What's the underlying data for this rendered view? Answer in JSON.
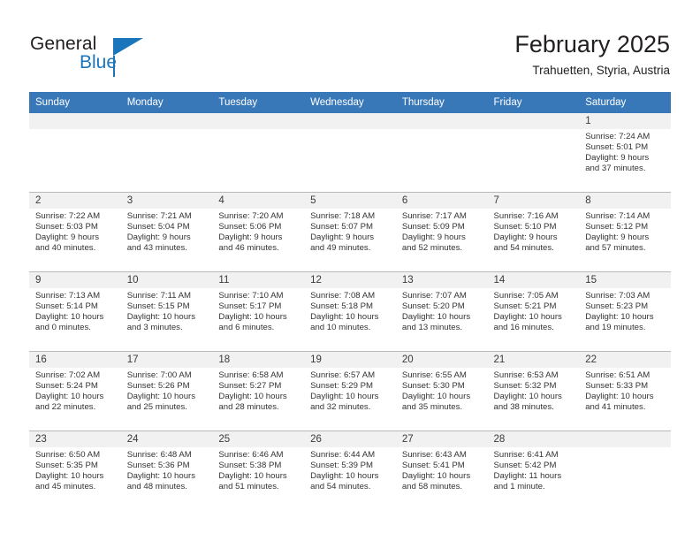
{
  "logo": {
    "word_one": "General",
    "word_two": "Blue",
    "triangle_icon": "triangle-icon",
    "brand_color": "#1b75bb"
  },
  "header": {
    "title": "February 2025",
    "location": "Trahuetten, Styria, Austria",
    "header_bg": "#3878b8"
  },
  "calendar": {
    "weekday_headers": [
      "Sunday",
      "Monday",
      "Tuesday",
      "Wednesday",
      "Thursday",
      "Friday",
      "Saturday"
    ],
    "weeks": [
      [
        {
          "day": "",
          "blank": true
        },
        {
          "day": "",
          "blank": true
        },
        {
          "day": "",
          "blank": true
        },
        {
          "day": "",
          "blank": true
        },
        {
          "day": "",
          "blank": true
        },
        {
          "day": "",
          "blank": true
        },
        {
          "day": "1",
          "sunrise": "Sunrise: 7:24 AM",
          "sunset": "Sunset: 5:01 PM",
          "daylight_1": "Daylight: 9 hours",
          "daylight_2": "and 37 minutes."
        }
      ],
      [
        {
          "day": "2",
          "sunrise": "Sunrise: 7:22 AM",
          "sunset": "Sunset: 5:03 PM",
          "daylight_1": "Daylight: 9 hours",
          "daylight_2": "and 40 minutes."
        },
        {
          "day": "3",
          "sunrise": "Sunrise: 7:21 AM",
          "sunset": "Sunset: 5:04 PM",
          "daylight_1": "Daylight: 9 hours",
          "daylight_2": "and 43 minutes."
        },
        {
          "day": "4",
          "sunrise": "Sunrise: 7:20 AM",
          "sunset": "Sunset: 5:06 PM",
          "daylight_1": "Daylight: 9 hours",
          "daylight_2": "and 46 minutes."
        },
        {
          "day": "5",
          "sunrise": "Sunrise: 7:18 AM",
          "sunset": "Sunset: 5:07 PM",
          "daylight_1": "Daylight: 9 hours",
          "daylight_2": "and 49 minutes."
        },
        {
          "day": "6",
          "sunrise": "Sunrise: 7:17 AM",
          "sunset": "Sunset: 5:09 PM",
          "daylight_1": "Daylight: 9 hours",
          "daylight_2": "and 52 minutes."
        },
        {
          "day": "7",
          "sunrise": "Sunrise: 7:16 AM",
          "sunset": "Sunset: 5:10 PM",
          "daylight_1": "Daylight: 9 hours",
          "daylight_2": "and 54 minutes."
        },
        {
          "day": "8",
          "sunrise": "Sunrise: 7:14 AM",
          "sunset": "Sunset: 5:12 PM",
          "daylight_1": "Daylight: 9 hours",
          "daylight_2": "and 57 minutes."
        }
      ],
      [
        {
          "day": "9",
          "sunrise": "Sunrise: 7:13 AM",
          "sunset": "Sunset: 5:14 PM",
          "daylight_1": "Daylight: 10 hours",
          "daylight_2": "and 0 minutes."
        },
        {
          "day": "10",
          "sunrise": "Sunrise: 7:11 AM",
          "sunset": "Sunset: 5:15 PM",
          "daylight_1": "Daylight: 10 hours",
          "daylight_2": "and 3 minutes."
        },
        {
          "day": "11",
          "sunrise": "Sunrise: 7:10 AM",
          "sunset": "Sunset: 5:17 PM",
          "daylight_1": "Daylight: 10 hours",
          "daylight_2": "and 6 minutes."
        },
        {
          "day": "12",
          "sunrise": "Sunrise: 7:08 AM",
          "sunset": "Sunset: 5:18 PM",
          "daylight_1": "Daylight: 10 hours",
          "daylight_2": "and 10 minutes."
        },
        {
          "day": "13",
          "sunrise": "Sunrise: 7:07 AM",
          "sunset": "Sunset: 5:20 PM",
          "daylight_1": "Daylight: 10 hours",
          "daylight_2": "and 13 minutes."
        },
        {
          "day": "14",
          "sunrise": "Sunrise: 7:05 AM",
          "sunset": "Sunset: 5:21 PM",
          "daylight_1": "Daylight: 10 hours",
          "daylight_2": "and 16 minutes."
        },
        {
          "day": "15",
          "sunrise": "Sunrise: 7:03 AM",
          "sunset": "Sunset: 5:23 PM",
          "daylight_1": "Daylight: 10 hours",
          "daylight_2": "and 19 minutes."
        }
      ],
      [
        {
          "day": "16",
          "sunrise": "Sunrise: 7:02 AM",
          "sunset": "Sunset: 5:24 PM",
          "daylight_1": "Daylight: 10 hours",
          "daylight_2": "and 22 minutes."
        },
        {
          "day": "17",
          "sunrise": "Sunrise: 7:00 AM",
          "sunset": "Sunset: 5:26 PM",
          "daylight_1": "Daylight: 10 hours",
          "daylight_2": "and 25 minutes."
        },
        {
          "day": "18",
          "sunrise": "Sunrise: 6:58 AM",
          "sunset": "Sunset: 5:27 PM",
          "daylight_1": "Daylight: 10 hours",
          "daylight_2": "and 28 minutes."
        },
        {
          "day": "19",
          "sunrise": "Sunrise: 6:57 AM",
          "sunset": "Sunset: 5:29 PM",
          "daylight_1": "Daylight: 10 hours",
          "daylight_2": "and 32 minutes."
        },
        {
          "day": "20",
          "sunrise": "Sunrise: 6:55 AM",
          "sunset": "Sunset: 5:30 PM",
          "daylight_1": "Daylight: 10 hours",
          "daylight_2": "and 35 minutes."
        },
        {
          "day": "21",
          "sunrise": "Sunrise: 6:53 AM",
          "sunset": "Sunset: 5:32 PM",
          "daylight_1": "Daylight: 10 hours",
          "daylight_2": "and 38 minutes."
        },
        {
          "day": "22",
          "sunrise": "Sunrise: 6:51 AM",
          "sunset": "Sunset: 5:33 PM",
          "daylight_1": "Daylight: 10 hours",
          "daylight_2": "and 41 minutes."
        }
      ],
      [
        {
          "day": "23",
          "sunrise": "Sunrise: 6:50 AM",
          "sunset": "Sunset: 5:35 PM",
          "daylight_1": "Daylight: 10 hours",
          "daylight_2": "and 45 minutes."
        },
        {
          "day": "24",
          "sunrise": "Sunrise: 6:48 AM",
          "sunset": "Sunset: 5:36 PM",
          "daylight_1": "Daylight: 10 hours",
          "daylight_2": "and 48 minutes."
        },
        {
          "day": "25",
          "sunrise": "Sunrise: 6:46 AM",
          "sunset": "Sunset: 5:38 PM",
          "daylight_1": "Daylight: 10 hours",
          "daylight_2": "and 51 minutes."
        },
        {
          "day": "26",
          "sunrise": "Sunrise: 6:44 AM",
          "sunset": "Sunset: 5:39 PM",
          "daylight_1": "Daylight: 10 hours",
          "daylight_2": "and 54 minutes."
        },
        {
          "day": "27",
          "sunrise": "Sunrise: 6:43 AM",
          "sunset": "Sunset: 5:41 PM",
          "daylight_1": "Daylight: 10 hours",
          "daylight_2": "and 58 minutes."
        },
        {
          "day": "28",
          "sunrise": "Sunrise: 6:41 AM",
          "sunset": "Sunset: 5:42 PM",
          "daylight_1": "Daylight: 11 hours",
          "daylight_2": "and 1 minute."
        },
        {
          "day": "",
          "blank": true
        }
      ]
    ]
  }
}
